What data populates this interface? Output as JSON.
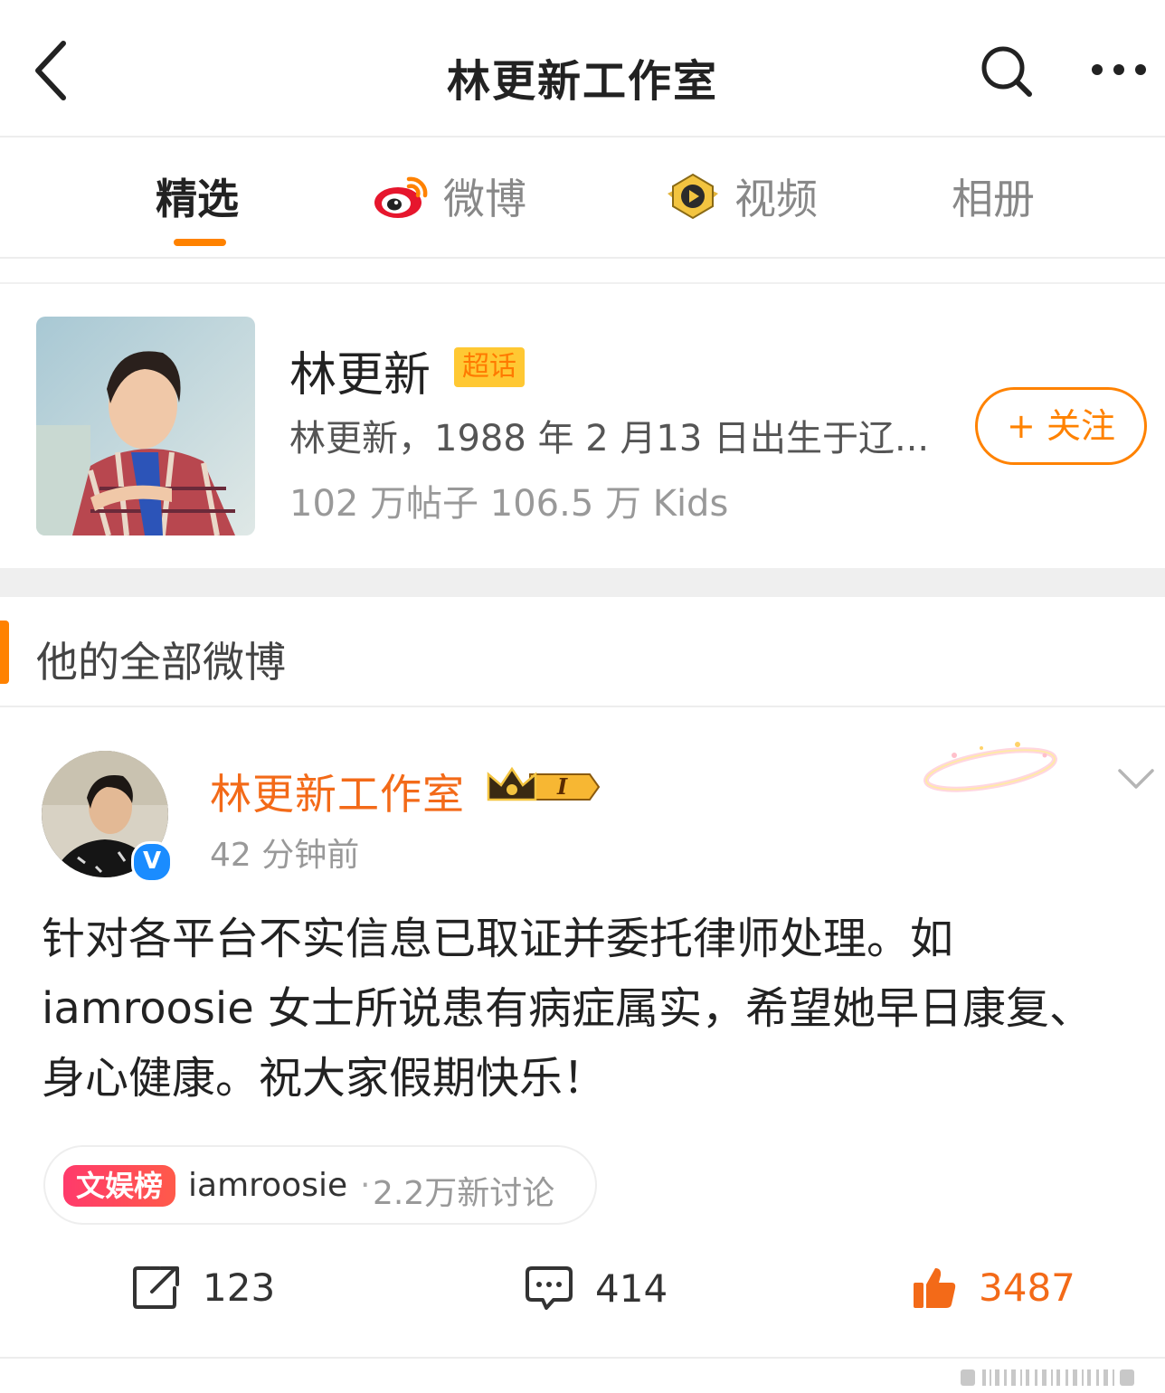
{
  "nav": {
    "title": "林更新工作室"
  },
  "tabs": [
    {
      "label": "精选",
      "active": true
    },
    {
      "label": "微博",
      "icon": "weibo-logo-icon"
    },
    {
      "label": "视频",
      "icon": "video-play-icon"
    },
    {
      "label": "相册"
    }
  ],
  "topic": {
    "name": "林更新",
    "badge": "超话",
    "description": "林更新，1988 年 2 月13 日出生于辽...",
    "stats": "102 万帖子 106.5 万 Kids",
    "follow_label": "+ 关注"
  },
  "section": {
    "title": "他的全部微博"
  },
  "post": {
    "author": "林更新工作室",
    "verified_mark": "V",
    "crown_level": "I",
    "time": "42 分钟前",
    "content": "针对各平台不实信息已取证并委托律师处理。如 iamroosie 女士所说患有病症属实，希望她早日康复、身心健康。祝大家假期快乐！",
    "hot": {
      "badge": "文娱榜",
      "topic": "iamroosie",
      "separator": "·",
      "count": "2.2万新讨论"
    },
    "actions": {
      "reposts": "123",
      "comments": "414",
      "likes": "3487"
    }
  },
  "colors": {
    "accent": "#ff8200",
    "author_name": "#f36a18",
    "verified": "#1a8cff",
    "hot_badge": "#ff3a6b"
  }
}
